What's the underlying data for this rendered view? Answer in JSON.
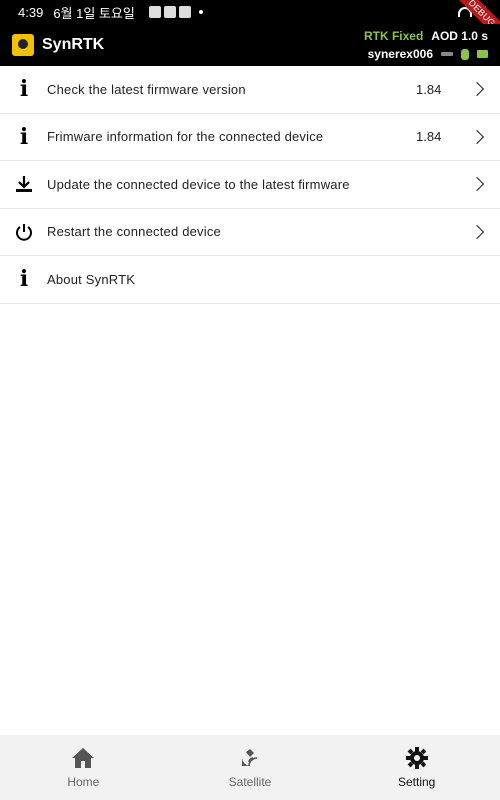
{
  "status_bar": {
    "time": "4:39",
    "date": "6월 1일 토요일",
    "debug_badge": "DEBUG"
  },
  "app_bar": {
    "title": "SynRTK",
    "rtk_status": "RTK Fixed",
    "aod": "AOD 1.0 s",
    "device_name": "synerex006",
    "accent_green": "#8BC34A"
  },
  "settings": {
    "items": [
      {
        "icon": "info-icon",
        "label": "Check the latest firmware version",
        "value": "1.84",
        "chevron": true
      },
      {
        "icon": "info-icon",
        "label": "Frimware information for the connected device",
        "value": "1.84",
        "chevron": true
      },
      {
        "icon": "download-icon",
        "label": "Update the connected device to the latest firmware",
        "value": "",
        "chevron": true
      },
      {
        "icon": "power-icon",
        "label": "Restart the connected device",
        "value": "",
        "chevron": true
      },
      {
        "icon": "info-icon",
        "label": "About SynRTK",
        "value": "",
        "chevron": false
      }
    ]
  },
  "bottom_nav": {
    "items": [
      {
        "icon": "home-icon",
        "label": "Home",
        "active": false
      },
      {
        "icon": "satellite-icon",
        "label": "Satellite",
        "active": false
      },
      {
        "icon": "gear-icon",
        "label": "Setting",
        "active": true
      }
    ]
  }
}
